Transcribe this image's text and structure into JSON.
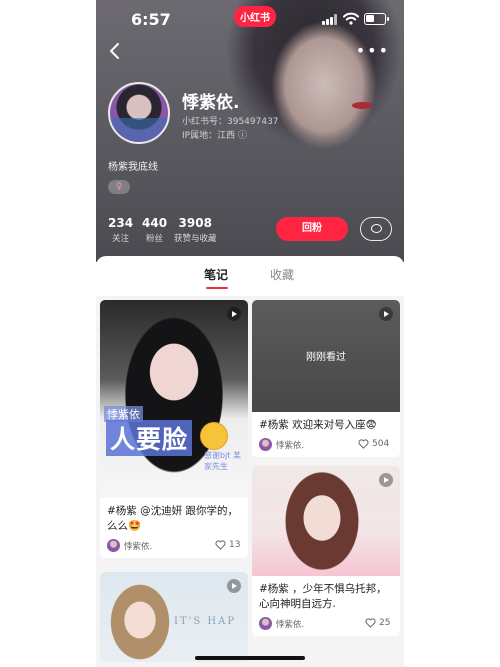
{
  "status_bar": {
    "time": "6:57",
    "app_badge": "小红书"
  },
  "profile": {
    "nickname": "悸紫依.",
    "redid": "小红书号：395497437",
    "ip": "IP属地：江西",
    "bio": "杨紫我底线",
    "gender_symbol": "♀",
    "stats": [
      {
        "value": "234",
        "label": "关注"
      },
      {
        "value": "440",
        "label": "粉丝"
      },
      {
        "value": "3908",
        "label": "获赞与收藏"
      }
    ],
    "follow_back_label": "回粉"
  },
  "tabs": [
    {
      "label": "笔记",
      "active": true
    },
    {
      "label": "收藏",
      "active": false
    }
  ],
  "notes": [
    {
      "title": "#杨紫 @沈迪妍 跟你学的，么么🤩",
      "author": "悸紫依.",
      "likes": "13",
      "overlay_small": "悸紫依",
      "overlay_big": "人要脸",
      "overlay_right": "感谢bjt 某家先生"
    },
    {
      "title": "#杨紫 欢迎来对号入座😨",
      "author": "悸紫依.",
      "likes": "504",
      "recent_label": "刚刚看过"
    },
    {
      "title": "#杨紫 ，少年不惧乌托邦，心向神明自远方.",
      "author": "悸紫依.",
      "likes": "25"
    },
    {
      "overlay_text": "IT'S HAP"
    }
  ],
  "colors": {
    "accent": "#ff2442",
    "header_bg": "#5e5c63"
  }
}
